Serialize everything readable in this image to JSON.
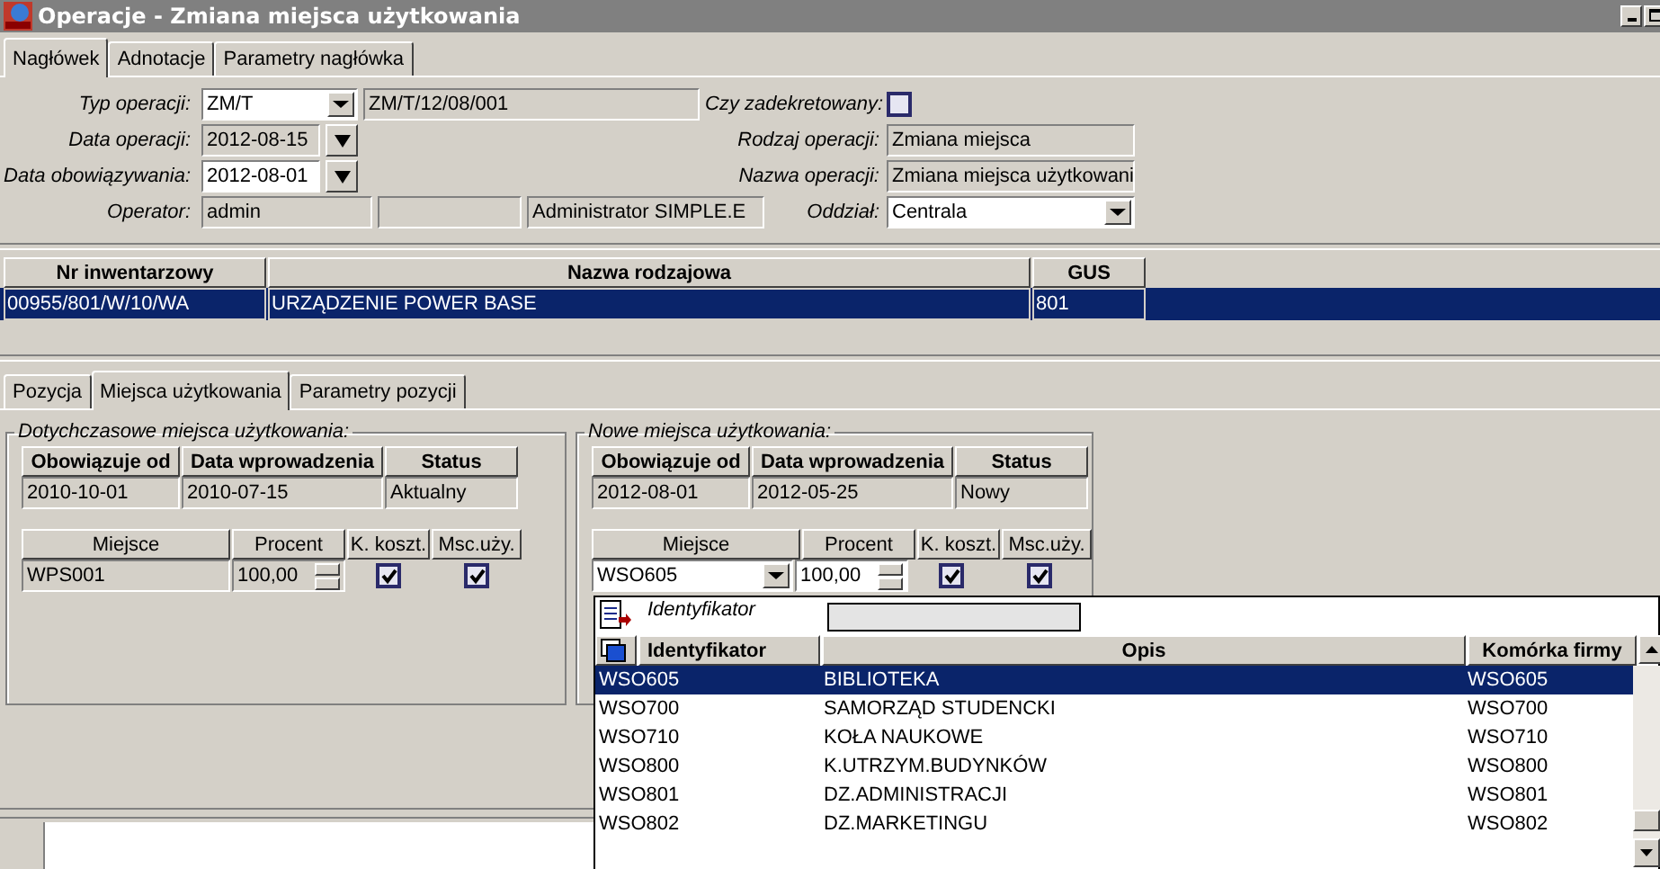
{
  "window": {
    "title": "Operacje - Zmiana miejsca użytkowania"
  },
  "header_tabs": [
    {
      "label": "Nagłówek",
      "selected": true
    },
    {
      "label": "Adnotacje",
      "selected": false
    },
    {
      "label": "Parametry nagłówka",
      "selected": false
    }
  ],
  "form": {
    "operation_type": {
      "label": "Typ operacji:",
      "code": "ZM/T",
      "number": "ZM/T/12/08/001"
    },
    "operation_date": {
      "label": "Data operacji:",
      "value": "2012-08-15"
    },
    "effective_date": {
      "label": "Data obowiązywania:",
      "value": "2012-08-01"
    },
    "operator": {
      "label": "Operator:",
      "login": "admin",
      "name": "Administrator SIMPLE.E"
    },
    "decreed": {
      "label": "Czy zadekretowany:",
      "checked": false
    },
    "operation_kind": {
      "label": "Rodzaj operacji:",
      "value": "Zmiana miejsca"
    },
    "operation_name": {
      "label": "Nazwa operacji:",
      "value": "Zmiana miejsca użytkowani"
    },
    "branch": {
      "label": "Oddział:",
      "value": "Centrala"
    }
  },
  "items_table": {
    "columns": [
      "Nr inwentarzowy",
      "Nazwa rodzajowa",
      "GUS"
    ],
    "rows": [
      {
        "cells": [
          "00955/801/W/10/WA",
          "URZĄDZENIE POWER BASE",
          "801"
        ],
        "selected": true
      }
    ]
  },
  "item_tabs": [
    {
      "label": "Pozycja",
      "selected": false
    },
    {
      "label": "Miejsca użytkowania",
      "selected": true
    },
    {
      "label": "Parametry pozycji",
      "selected": false
    }
  ],
  "locations": [
    {
      "title": "Dotychczasowe miejsca użytkowania:",
      "columns": [
        "Obowiązuje od",
        "Data wprowadzenia",
        "Status"
      ],
      "values": [
        "2010-10-01",
        "2010-07-15",
        "Aktualny"
      ],
      "place_columns": [
        "Miejsce",
        "Procent",
        "K. koszt.",
        "Msc.uży."
      ],
      "place": "WPS001",
      "percent": "100,00",
      "editable": false,
      "cost_center": true,
      "usage_place": true
    },
    {
      "title": "Nowe miejsca użytkowania:",
      "columns": [
        "Obowiązuje od",
        "Data wprowadzenia",
        "Status"
      ],
      "values": [
        "2012-08-01",
        "2012-05-25",
        "Nowy"
      ],
      "place_columns": [
        "Miejsce",
        "Procent",
        "K. koszt.",
        "Msc.uży."
      ],
      "place": "WSO605",
      "percent": "100,00",
      "editable": true,
      "cost_center": true,
      "usage_place": true
    }
  ],
  "lookup": {
    "filter_label": "Identyfikator",
    "columns": [
      "Identyfikator",
      "Opis",
      "Komórka firmy"
    ],
    "rows": [
      {
        "cells": [
          "WSO605",
          "BIBLIOTEKA",
          "WSO605"
        ],
        "selected": true
      },
      {
        "cells": [
          "WSO700",
          "SAMORZĄD STUDENCKI",
          "WSO700"
        ],
        "selected": false
      },
      {
        "cells": [
          "WSO710",
          "KOŁA NAUKOWE",
          "WSO710"
        ],
        "selected": false
      },
      {
        "cells": [
          "WSO800",
          "K.UTRZYM.BUDYNKÓW",
          "WSO800"
        ],
        "selected": false
      },
      {
        "cells": [
          "WSO801",
          "DZ.ADMINISTRACJI",
          "WSO801"
        ],
        "selected": false
      },
      {
        "cells": [
          "WSO802",
          "DZ.MARKETINGU",
          "WSO802"
        ],
        "selected": false
      }
    ]
  }
}
